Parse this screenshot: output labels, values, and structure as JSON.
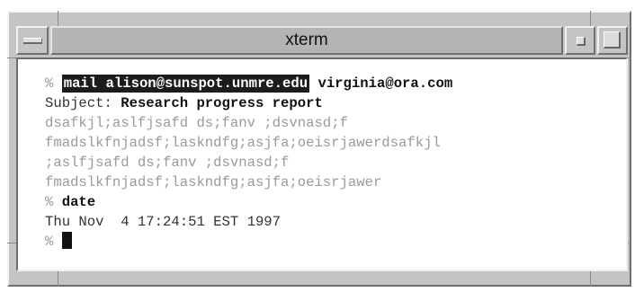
{
  "window": {
    "title": "xterm"
  },
  "terminal": {
    "prompt": "%",
    "command1": {
      "highlighted": "mail alison@sunspot.unmre.edu",
      "rest": "virginia@ora.com"
    },
    "subject_label": "Subject:",
    "subject_value": "Research progress report",
    "body_lines": [
      "dsafkjl;aslfjsafd ds;fanv ;dsvnasd;f",
      "fmadslkfnjadsf;laskndfg;asjfa;oeisrjawerdsafkjl",
      ";aslfjsafd ds;fanv ;dsvnasd;f",
      "fmadslkfnjadsf;laskndfg;asjfa;oeisrjawer"
    ],
    "command2": "date",
    "date_output": "Thu Nov  4 17:24:51 EST 1997"
  },
  "colors": {
    "frame": "#c4c4c4",
    "title_bar": "#b4b4b4",
    "terminal_bg": "#ffffff",
    "highlight_bg": "#1c1c1c",
    "faint_text": "#9a9a9a"
  }
}
